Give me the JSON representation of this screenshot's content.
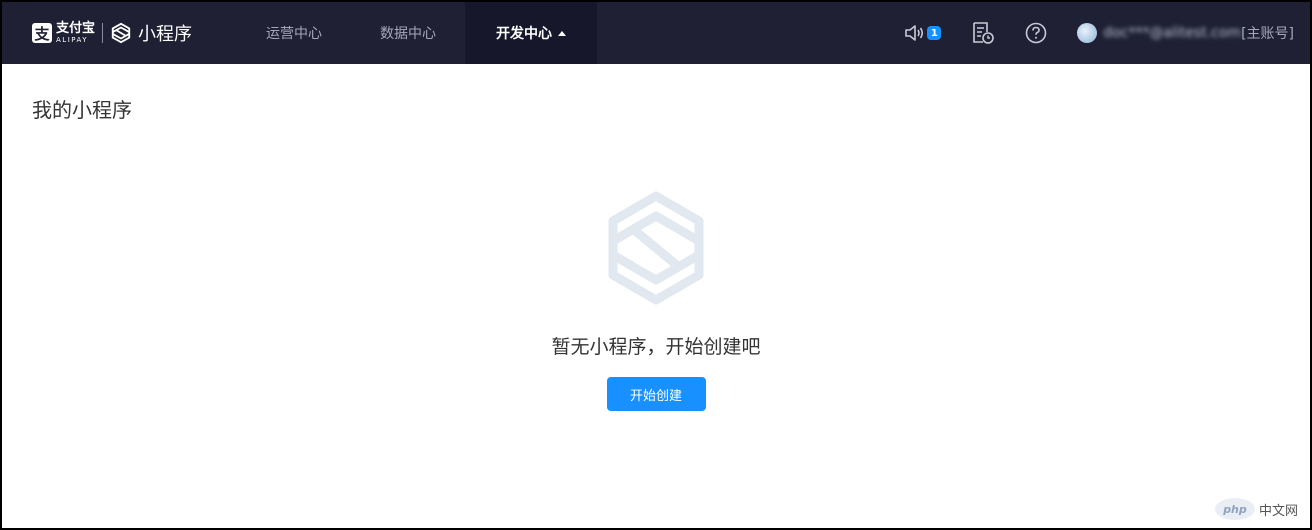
{
  "brand": {
    "alipay_mark": "支",
    "alipay_cn": "支付宝",
    "alipay_en": "ALIPAY",
    "product_title": "小程序"
  },
  "nav": {
    "items": [
      {
        "label": "运营中心",
        "active": false
      },
      {
        "label": "数据中心",
        "active": false
      },
      {
        "label": "开发中心",
        "active": true
      }
    ]
  },
  "header_right": {
    "notification_count": "1",
    "account_email": "doc***@alitest.com",
    "account_role": "[主账号]"
  },
  "page": {
    "title": "我的小程序"
  },
  "empty_state": {
    "message": "暂无小程序，开始创建吧",
    "button_label": "开始创建"
  },
  "watermark": {
    "mark": "php",
    "text": "中文网"
  },
  "colors": {
    "topbar_bg": "#1f2034",
    "active_nav_bg": "#16172a",
    "primary_button": "#1890ff",
    "badge": "#1890ff"
  }
}
